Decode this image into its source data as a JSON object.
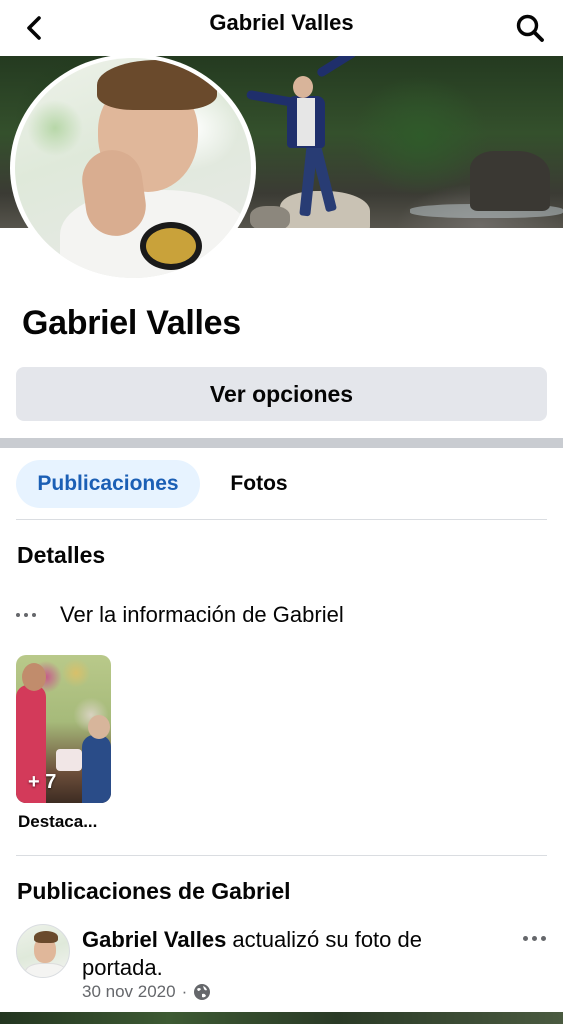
{
  "header": {
    "title": "Gabriel Valles",
    "back_icon": "chevron-left-icon",
    "search_icon": "search-icon"
  },
  "profile": {
    "name": "Gabriel Valles",
    "options_button": "Ver opciones"
  },
  "tabs": [
    {
      "label": "Publicaciones",
      "active": true
    },
    {
      "label": "Fotos",
      "active": false
    }
  ],
  "details": {
    "title": "Detalles",
    "info_link": "Ver la información de Gabriel"
  },
  "highlights": [
    {
      "count_label": "+ 7",
      "label": "Destaca..."
    }
  ],
  "posts_section": {
    "title": "Publicaciones de Gabriel"
  },
  "post": {
    "author": "Gabriel Valles",
    "action": " actualizó su foto de portada.",
    "date": "30 nov 2020",
    "separator": "·",
    "audience_icon": "globe-icon"
  },
  "colors": {
    "accent": "#1b5fb5",
    "tab_active_bg": "#e7f3ff",
    "button_bg": "#e4e6eb",
    "secondary_text": "#65676b"
  }
}
